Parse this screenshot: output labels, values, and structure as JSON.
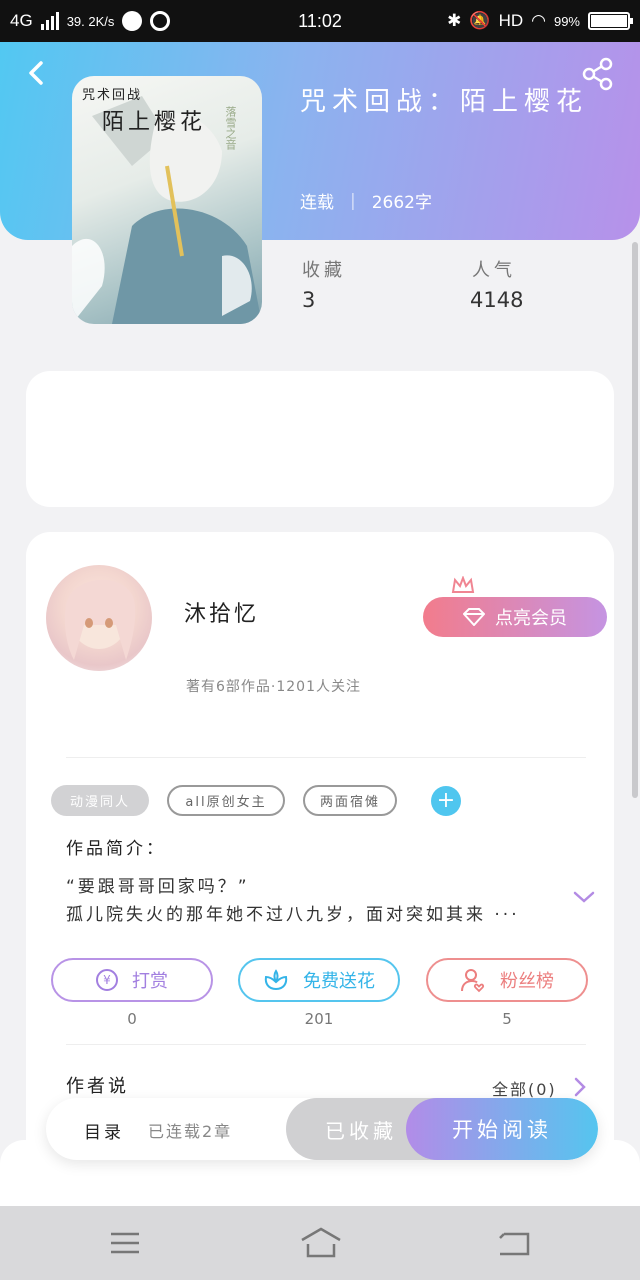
{
  "status_bar": {
    "network": "4G",
    "speed": "39. 2K/s",
    "time": "11:02",
    "hd": "HD",
    "battery": "99%"
  },
  "header": {
    "book_title": "咒术回战：陌上樱花",
    "status": "连载",
    "word_count": "2662字",
    "stats": {
      "favorites_label": "收藏",
      "favorites_value": "3",
      "popularity_label": "人气",
      "popularity_value": "4148"
    },
    "cover": {
      "line1": "咒术回战",
      "line2": "陌上樱花",
      "side_text": "落雪之音"
    },
    "icons": {
      "back": "back-arrow-icon",
      "share": "share-icon"
    }
  },
  "author": {
    "name": "沐拾忆",
    "summary": "著有6部作品·1201人关注",
    "vip_button": "点亮会员"
  },
  "tags": [
    "动漫同人",
    "all原创女主",
    "两面宿傩"
  ],
  "intro": {
    "title": "作品简介：",
    "line1": "“要跟哥哥回家吗？”",
    "line2": "孤儿院失火的那年她不过八九岁，面对突如其来 ···"
  },
  "actions": [
    {
      "label": "打赏",
      "count": "0",
      "icon": "yen-coin-icon"
    },
    {
      "label": "免费送花",
      "count": "201",
      "icon": "flower-icon"
    },
    {
      "label": "粉丝榜",
      "count": "5",
      "icon": "fan-user-icon"
    }
  ],
  "author_says": {
    "title": "作者说",
    "all": "全部(0)"
  },
  "bottom_bar": {
    "catalog": "目录",
    "chapters": "已连载2章",
    "collected": "已收藏",
    "read": "开始阅读"
  },
  "colors": {
    "gradient_start": "#52c8f2",
    "gradient_end": "#b791ea",
    "accent_blue": "#4fc6ef",
    "accent_purple": "#a27fe0",
    "accent_red": "#ec7f7f"
  }
}
